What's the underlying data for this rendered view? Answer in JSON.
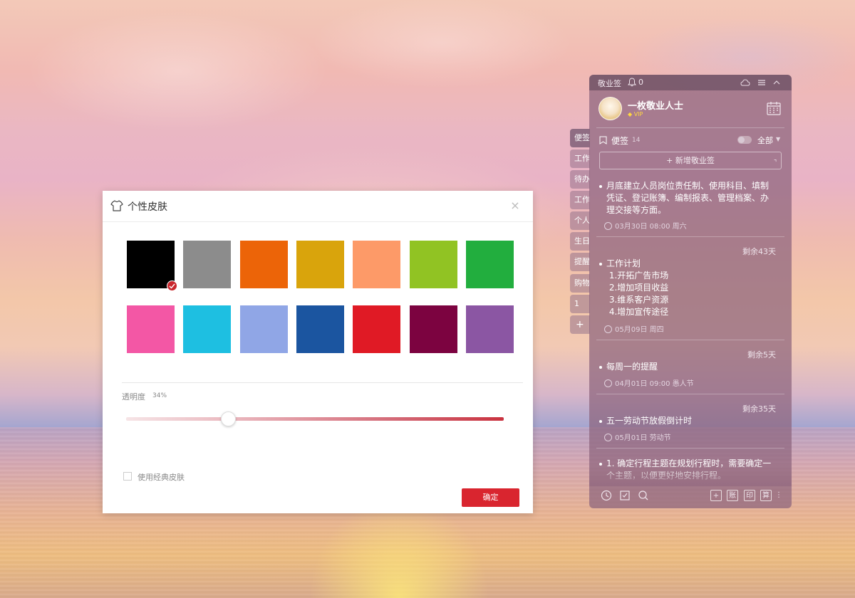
{
  "skin_dialog": {
    "title": "个性皮肤",
    "close_label": "×",
    "swatches": [
      {
        "color": "#000000",
        "selected": true
      },
      {
        "color": "#8c8c8c",
        "selected": false
      },
      {
        "color": "#ec6408",
        "selected": false
      },
      {
        "color": "#d9a40c",
        "selected": false
      },
      {
        "color": "#fd9a68",
        "selected": false
      },
      {
        "color": "#91c323",
        "selected": false
      },
      {
        "color": "#22ae3e",
        "selected": false
      },
      {
        "color": "#f357a5",
        "selected": false
      },
      {
        "color": "#1ebfe1",
        "selected": false
      },
      {
        "color": "#90a6e6",
        "selected": false
      },
      {
        "color": "#1b55a0",
        "selected": false
      },
      {
        "color": "#e01a25",
        "selected": false
      },
      {
        "color": "#7c0340",
        "selected": false
      },
      {
        "color": "#8b56a3",
        "selected": false
      }
    ],
    "opacity_label": "透明度",
    "opacity_value": "34%",
    "opacity_fraction": 0.27,
    "classic_skin_label": "使用经典皮肤",
    "classic_skin_checked": false,
    "confirm_label": "确定"
  },
  "side_tabs": [
    {
      "label": "便签",
      "active": true
    },
    {
      "label": "工作",
      "active": false
    },
    {
      "label": "待办",
      "active": false
    },
    {
      "label": "工作",
      "active": false
    },
    {
      "label": "个人",
      "active": false
    },
    {
      "label": "生日",
      "active": false
    },
    {
      "label": "提醒",
      "active": false
    },
    {
      "label": "购物",
      "active": false
    },
    {
      "label": "1",
      "active": false
    },
    {
      "label": "+",
      "active": false
    }
  ],
  "panel": {
    "app_name": "敬业签",
    "bell_count": "0",
    "user": {
      "name": "一枚敬业人士",
      "badge": "VIP"
    },
    "section_label": "便签",
    "section_count": "14",
    "filter_label": "全部",
    "new_note_label": "+ 新增敬业签",
    "notes": [
      {
        "remaining": "",
        "lines": [
          "月底建立人员岗位责任制、使用科目、填制",
          "凭证、登记账簿、编制报表、管理档案、办",
          "理交接等方面。"
        ],
        "meta": "03月30日 08:00 周六"
      },
      {
        "remaining": "剩余43天",
        "lines": [
          "工作计划",
          " 1.开拓广告市场",
          " 2.增加项目收益",
          " 3.维系客户资源",
          " 4.增加宣传途径"
        ],
        "meta": "05月09日 周四"
      },
      {
        "remaining": "剩余5天",
        "lines": [
          "每周一的提醒"
        ],
        "meta": "04月01日 09:00 愚人节"
      },
      {
        "remaining": "剩余35天",
        "lines": [
          "五一劳动节放假倒计时"
        ],
        "meta": "05月01日 劳动节"
      },
      {
        "remaining": "",
        "lines": [
          "1. 确定行程主题在规划行程时，需要确定一",
          "个主题，以便更好地安排行程。"
        ],
        "meta": ""
      }
    ],
    "bottom_icons": {
      "add": "+",
      "account": "账",
      "print": "印",
      "calc": "算"
    }
  }
}
